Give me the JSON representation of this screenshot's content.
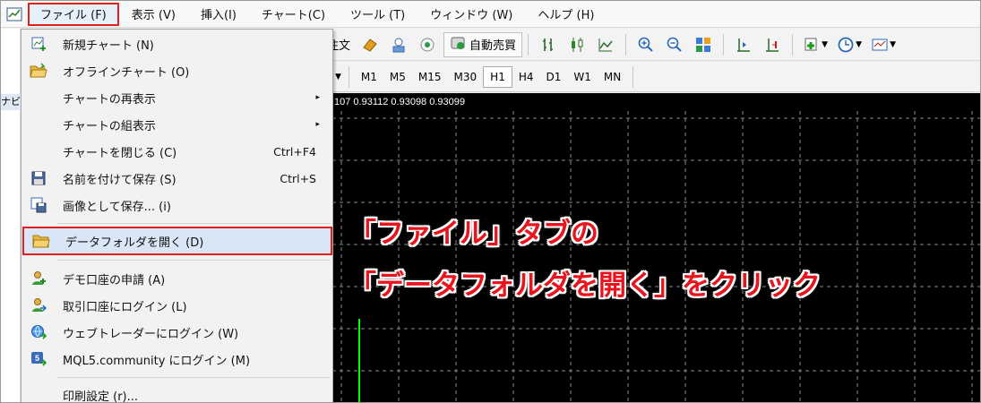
{
  "menubar": {
    "items": [
      {
        "label": "ファイル (F)",
        "active": true
      },
      {
        "label": "表示 (V)"
      },
      {
        "label": "挿入(I)"
      },
      {
        "label": "チャート(C)"
      },
      {
        "label": "ツール (T)"
      },
      {
        "label": "ウィンドウ (W)"
      },
      {
        "label": "ヘルプ (H)"
      }
    ]
  },
  "toolbar": {
    "order_text": "注文",
    "auto_trade_label": "自動売買",
    "timeframes": [
      "M1",
      "M5",
      "M15",
      "M30",
      "H1",
      "H4",
      "D1",
      "W1",
      "MN"
    ],
    "selected_timeframe": "H1"
  },
  "navigator": {
    "label": "ナビ"
  },
  "chart": {
    "header_text": "107 0.93112 0.93098 0.93099",
    "background": "#000000",
    "grid_color": "#8a8a8a",
    "candle_color": "#00ff00"
  },
  "file_menu": {
    "items": [
      {
        "label": "新規チャート (N)",
        "icon": "new-chart-icon"
      },
      {
        "label": "オフラインチャート (O)",
        "icon": "folder-open-icon"
      },
      {
        "label": "チャートの再表示",
        "submenu": "▸"
      },
      {
        "label": "チャートの組表示",
        "submenu": "▸"
      },
      {
        "label": "チャートを閉じる (C)",
        "shortcut": "Ctrl+F4"
      },
      {
        "label": "名前を付けて保存 (S)",
        "shortcut": "Ctrl+S",
        "icon": "save-icon"
      },
      {
        "label": "画像として保存... (i)",
        "icon": "save-image-icon"
      },
      {
        "label": "データフォルダを開く (D)",
        "icon": "folder-icon",
        "highlight": true
      },
      {
        "label": "デモ口座の申請 (A)",
        "icon": "user-add-icon"
      },
      {
        "label": "取引口座にログイン (L)",
        "icon": "user-login-icon"
      },
      {
        "label": "ウェブトレーダーにログイン (W)",
        "icon": "web-login-icon"
      },
      {
        "label": "MQL5.community にログイン (M)",
        "icon": "mql5-icon"
      },
      {
        "label": "印刷設定 (r)..."
      }
    ]
  },
  "annotation": {
    "line1": "「ファイル」タブの",
    "line2": "「データフォルダを開く」をクリック",
    "color": "#e8141e"
  },
  "colors": {
    "highlight_border": "#e02020",
    "highlight_bg": "#d9e6f5"
  }
}
